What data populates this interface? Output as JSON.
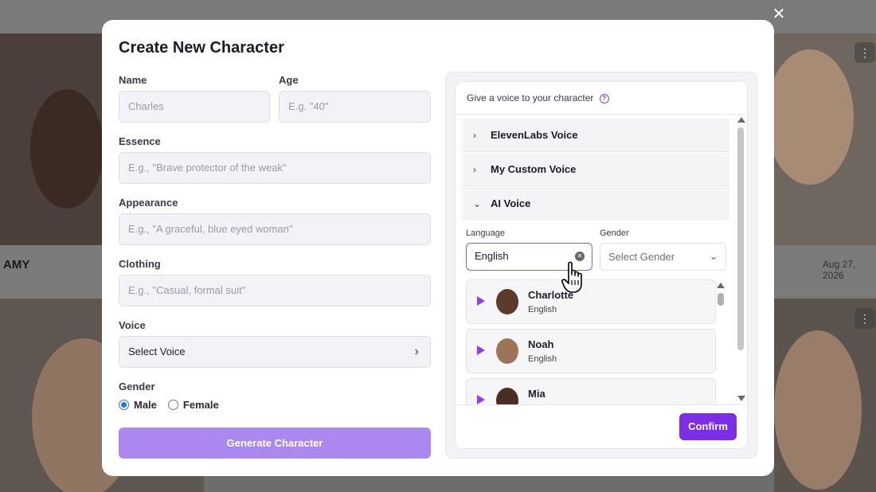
{
  "background": {
    "card_name": "AMY",
    "card_date": "Aug 27, 2026",
    "kebab_icon": "⋮",
    "close_icon": "✕"
  },
  "modal": {
    "title": "Create New Character",
    "name": {
      "label": "Name",
      "placeholder": "Charles"
    },
    "age": {
      "label": "Age",
      "placeholder": "E.g. \"40\""
    },
    "essence": {
      "label": "Essence",
      "placeholder": "E.g., \"Brave protector of the weak\""
    },
    "appearance": {
      "label": "Appearance",
      "placeholder": "E.g., \"A graceful, blue eyed woman\""
    },
    "clothing": {
      "label": "Clothing",
      "placeholder": "E.g., \"Casual, formal suit\""
    },
    "voice": {
      "label": "Voice",
      "value": "Select Voice"
    },
    "gender": {
      "label": "Gender",
      "options": [
        "Male",
        "Female"
      ],
      "selected": "Male"
    },
    "generate_label": "Generate Character"
  },
  "voice_panel": {
    "header": "Give a voice to your character",
    "help_icon": "?",
    "sections": [
      {
        "label": "ElevenLabs Voice",
        "expanded": false
      },
      {
        "label": "My Custom Voice",
        "expanded": false
      },
      {
        "label": "AI Voice",
        "expanded": true
      }
    ],
    "language": {
      "label": "Language",
      "value": "English"
    },
    "gender": {
      "label": "Gender",
      "placeholder": "Select Gender"
    },
    "voices": [
      {
        "name": "Charlotte",
        "language": "English"
      },
      {
        "name": "Noah",
        "language": "English"
      },
      {
        "name": "Mia",
        "language": ""
      }
    ],
    "confirm_label": "Confirm"
  },
  "colors": {
    "accent": "#7b2ee6",
    "generate_button": "#ab88f0",
    "radio_selected": "#2b6ff0"
  }
}
